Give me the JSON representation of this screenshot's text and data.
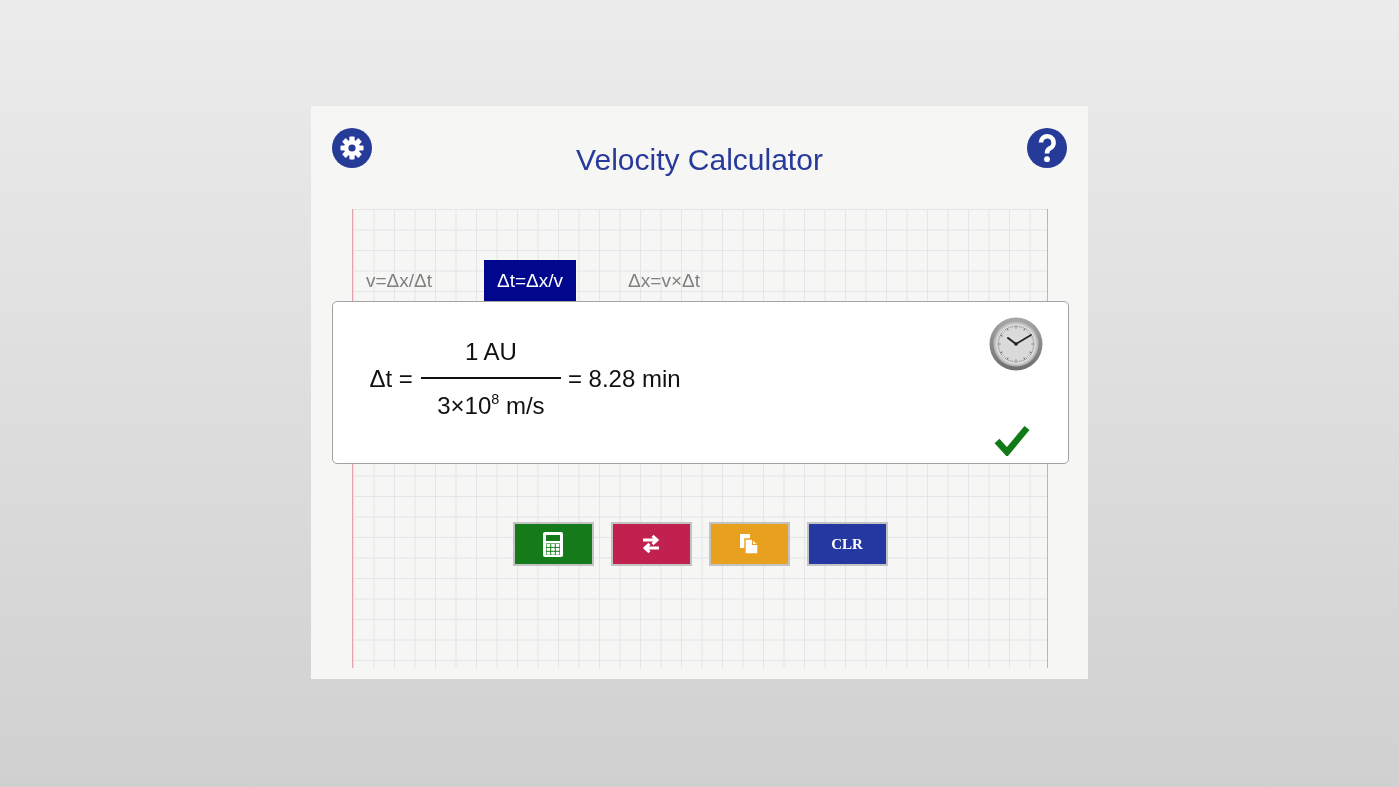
{
  "header": {
    "title": "Velocity Calculator"
  },
  "tabs": [
    {
      "label": "v=Δx/Δt",
      "selected": false
    },
    {
      "label": "Δt=Δx/v",
      "selected": true
    },
    {
      "label": "Δx=v×Δt",
      "selected": false
    }
  ],
  "result": {
    "lhs": "Δt =",
    "numerator": "1 AU",
    "denominator": "3×10$^{8}$ m/s",
    "rhs": "= 8.28 min",
    "verified": true
  },
  "buttons": [
    {
      "kind": "calculator",
      "color": "#157b1a"
    },
    {
      "kind": "swap",
      "color": "#c0214f"
    },
    {
      "kind": "copy",
      "color": "#e8a11f"
    },
    {
      "kind": "text",
      "label": "CLR",
      "color": "#2537a0"
    }
  ]
}
